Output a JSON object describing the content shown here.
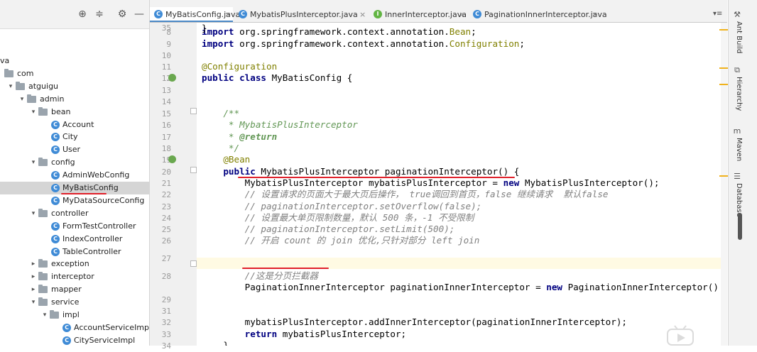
{
  "project_tree": {
    "rows": [
      {
        "label": "va",
        "kind": "text",
        "indent": 0,
        "arrow": ""
      },
      {
        "label": "com",
        "kind": "folder",
        "indent": 0,
        "arrow": ""
      },
      {
        "label": "atguigu",
        "kind": "folder",
        "indent": 1,
        "arrow": "▾"
      },
      {
        "label": "admin",
        "kind": "folder",
        "indent": 2,
        "arrow": "▾"
      },
      {
        "label": "bean",
        "kind": "folder",
        "indent": 3,
        "arrow": "▾"
      },
      {
        "label": "Account",
        "kind": "class",
        "indent": 4,
        "arrow": ""
      },
      {
        "label": "City",
        "kind": "class",
        "indent": 4,
        "arrow": ""
      },
      {
        "label": "User",
        "kind": "class",
        "indent": 4,
        "arrow": ""
      },
      {
        "label": "config",
        "kind": "folder",
        "indent": 3,
        "arrow": "▾"
      },
      {
        "label": "AdminWebConfig",
        "kind": "class",
        "indent": 4,
        "arrow": ""
      },
      {
        "label": "MyBatisConfig",
        "kind": "class",
        "indent": 4,
        "arrow": "",
        "selected": true
      },
      {
        "label": "MyDataSourceConfig",
        "kind": "class",
        "indent": 4,
        "arrow": ""
      },
      {
        "label": "controller",
        "kind": "folder",
        "indent": 3,
        "arrow": "▾"
      },
      {
        "label": "FormTestController",
        "kind": "class",
        "indent": 4,
        "arrow": ""
      },
      {
        "label": "IndexController",
        "kind": "class",
        "indent": 4,
        "arrow": ""
      },
      {
        "label": "TableController",
        "kind": "class",
        "indent": 4,
        "arrow": ""
      },
      {
        "label": "exception",
        "kind": "folder",
        "indent": 3,
        "arrow": "▸"
      },
      {
        "label": "interceptor",
        "kind": "folder",
        "indent": 3,
        "arrow": "▸"
      },
      {
        "label": "mapper",
        "kind": "folder",
        "indent": 3,
        "arrow": "▸"
      },
      {
        "label": "service",
        "kind": "folder",
        "indent": 3,
        "arrow": "▾"
      },
      {
        "label": "impl",
        "kind": "folder",
        "indent": 4,
        "arrow": "▾"
      },
      {
        "label": "AccountServiceImpl",
        "kind": "class",
        "indent": 5,
        "arrow": ""
      },
      {
        "label": "CityServiceImpl",
        "kind": "class",
        "indent": 5,
        "arrow": ""
      }
    ]
  },
  "toolbar_icons": [
    "locate-icon",
    "collapse-icon",
    "gear-icon",
    "hide-icon"
  ],
  "tabs": [
    {
      "label": "MyBatisConfig.java",
      "icon": "C",
      "color": "#3f8bd6",
      "active": true
    },
    {
      "label": "MybatisPlusInterceptor.java",
      "icon": "C",
      "color": "#3f8bd6",
      "active": false
    },
    {
      "label": "InnerInterceptor.java",
      "icon": "I",
      "color": "#62b543",
      "active": false
    },
    {
      "label": "PaginationInnerInterceptor.java",
      "icon": "C",
      "color": "#3f8bd6",
      "active": false
    }
  ],
  "editor": {
    "lines": [
      {
        "n": "8",
        "tokens": [
          [
            "kw",
            "import"
          ],
          [
            "id",
            " org.springframework.context.annotation."
          ],
          [
            "ann",
            "Bean"
          ],
          [
            "id",
            ";"
          ]
        ]
      },
      {
        "n": "9",
        "tokens": [
          [
            "kw",
            "import"
          ],
          [
            "id",
            " org.springframework.context.annotation."
          ],
          [
            "ann",
            "Configuration"
          ],
          [
            "id",
            ";"
          ]
        ]
      },
      {
        "n": "10",
        "tokens": []
      },
      {
        "n": "11",
        "tokens": [
          [
            "ann",
            "@Configuration"
          ]
        ]
      },
      {
        "n": "12",
        "tokens": [
          [
            "kw",
            "public class"
          ],
          [
            "id",
            " MyBatisConfig {"
          ]
        ]
      },
      {
        "n": "13",
        "tokens": []
      },
      {
        "n": "14",
        "tokens": []
      },
      {
        "n": "15",
        "tokens": [
          [
            "doc",
            "    /**"
          ]
        ]
      },
      {
        "n": "16",
        "tokens": [
          [
            "doc",
            "     * MybatisPlusInterceptor"
          ]
        ]
      },
      {
        "n": "17",
        "tokens": [
          [
            "doc",
            "     * "
          ],
          [
            "doctag",
            "@return"
          ]
        ]
      },
      {
        "n": "18",
        "tokens": [
          [
            "doc",
            "     */"
          ]
        ]
      },
      {
        "n": "19",
        "tokens": [
          [
            "ann",
            "    @Bean"
          ]
        ]
      },
      {
        "n": "20",
        "tokens": [
          [
            "kw",
            "    public"
          ],
          [
            "id",
            " MybatisPlusInterceptor paginationInterceptor() {"
          ]
        ]
      },
      {
        "n": "21",
        "tokens": [
          [
            "id",
            "        MybatisPlusInterceptor mybatisPlusInterceptor = "
          ],
          [
            "kw",
            "new"
          ],
          [
            "id",
            " MybatisPlusInterceptor();"
          ]
        ]
      },
      {
        "n": "22",
        "tokens": [
          [
            "com",
            "        // 设置请求的页面大于最大页后操作， true调回到首页，false 继续请求  默认false"
          ]
        ]
      },
      {
        "n": "23",
        "tokens": [
          [
            "com",
            "        // paginationInterceptor.setOverflow(false);"
          ]
        ]
      },
      {
        "n": "24",
        "tokens": [
          [
            "com",
            "        // 设置最大单页限制数量，默认 500 条，-1 不受限制"
          ]
        ]
      },
      {
        "n": "25",
        "tokens": [
          [
            "com",
            "        // paginationInterceptor.setLimit(500);"
          ]
        ]
      },
      {
        "n": "26",
        "tokens": [
          [
            "com",
            "        // 开启 count 的 join 优化,只针对部分 left join"
          ]
        ]
      },
      {
        "n": "27",
        "tokens": []
      },
      {
        "n": "28",
        "tokens": [
          [
            "com",
            "        //这是分页拦截器"
          ]
        ]
      },
      {
        "n": "",
        "tokens": [
          [
            "id",
            "        PaginationInnerInterceptor paginationInnerInterceptor = "
          ],
          [
            "kw",
            "new"
          ],
          [
            "id",
            " PaginationInnerInterceptor()"
          ]
        ]
      },
      {
        "n": "29",
        "tokens": []
      },
      {
        "n": "31",
        "tokens": []
      },
      {
        "n": "32",
        "tokens": [
          [
            "id",
            "        mybatisPlusInterceptor.addInnerInterceptor(paginationInnerInterceptor);"
          ]
        ]
      },
      {
        "n": "33",
        "tokens": [
          [
            "kw",
            "        return"
          ],
          [
            "id",
            " mybatisPlusInterceptor;"
          ]
        ]
      },
      {
        "n": "34",
        "tokens": [
          [
            "id",
            "    }"
          ]
        ]
      },
      {
        "n": "35",
        "tokens": [
          [
            "id",
            "}"
          ]
        ]
      }
    ]
  },
  "tool_windows": [
    {
      "label": "Ant Build",
      "icon": "ant-icon"
    },
    {
      "label": "Hierarchy",
      "icon": "hierarchy-icon"
    },
    {
      "label": "Maven",
      "icon": "maven-icon"
    },
    {
      "label": "Database",
      "icon": "database-icon"
    }
  ],
  "colors": {
    "accent": "#4a88c7",
    "selection": "#d5d5d5",
    "keyword": "#000080",
    "annotation": "#808000",
    "comment": "#808080",
    "doc": "#629755",
    "underline": "#e0202a",
    "current_line": "#fffae3"
  }
}
